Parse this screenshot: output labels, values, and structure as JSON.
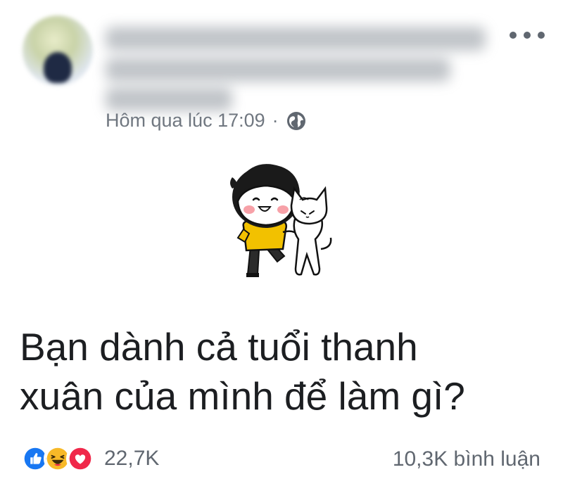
{
  "post": {
    "timestamp": "Hôm qua lúc 17:09",
    "separator": "·",
    "privacy_icon": "globe-icon",
    "text_lines": [
      "Bạn dành cả tuổi thanh",
      "xuân của mình để làm gì?"
    ],
    "reactions": {
      "icons": [
        "like-icon",
        "haha-icon",
        "love-icon"
      ],
      "count": "22,7K"
    },
    "comments": "10,3K bình luận"
  },
  "colors": {
    "like": "#1877f2",
    "haha": "#f7b928",
    "love": "#f0284a",
    "meta_text": "#707780"
  }
}
